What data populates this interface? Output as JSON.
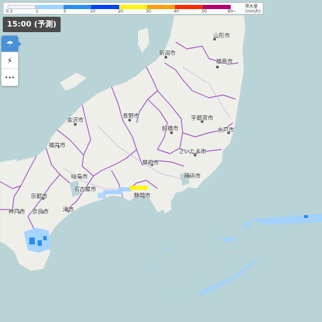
{
  "legend": {
    "ticks": [
      "0.3",
      "1",
      "5",
      "10",
      "20",
      "30",
      "40",
      "50",
      "80~"
    ],
    "unit": "降水量\n(mm/h)",
    "colors": [
      "#f2f2ff",
      "#a0d2ff",
      "#2c8cf0",
      "#0041ff",
      "#fff500",
      "#ffa000",
      "#ff2800",
      "#b40068"
    ]
  },
  "time_label": "15:00 (予測)",
  "controls": [
    {
      "name": "rain-icon",
      "glyph": "☂"
    },
    {
      "name": "lightning-icon",
      "glyph": "⚡"
    },
    {
      "name": "more-icon",
      "glyph": "•••"
    }
  ],
  "cities": [
    {
      "key": "yamagata",
      "label": "山形市"
    },
    {
      "key": "niigata",
      "label": "新潟市"
    },
    {
      "key": "fukushima",
      "label": "福島市"
    },
    {
      "key": "kanazawa",
      "label": "金沢市"
    },
    {
      "key": "nagano",
      "label": "長野市"
    },
    {
      "key": "utsunomiya",
      "label": "宇都宮市"
    },
    {
      "key": "maebashi",
      "label": "前橋市"
    },
    {
      "key": "mito",
      "label": "水戸市"
    },
    {
      "key": "fukui",
      "label": "福井市"
    },
    {
      "key": "saitama",
      "label": "さいたま市"
    },
    {
      "key": "kofu",
      "label": "甲府市"
    },
    {
      "key": "gifu",
      "label": "岐阜市"
    },
    {
      "key": "yokohama",
      "label": "横浜市"
    },
    {
      "key": "nagoya",
      "label": "名古屋市"
    },
    {
      "key": "kyoto",
      "label": "京都市"
    },
    {
      "key": "shizuoka",
      "label": "静岡市"
    },
    {
      "key": "kobe",
      "label": "神戸市"
    },
    {
      "key": "nara",
      "label": "奈良市"
    },
    {
      "key": "tsu",
      "label": "津市"
    }
  ]
}
